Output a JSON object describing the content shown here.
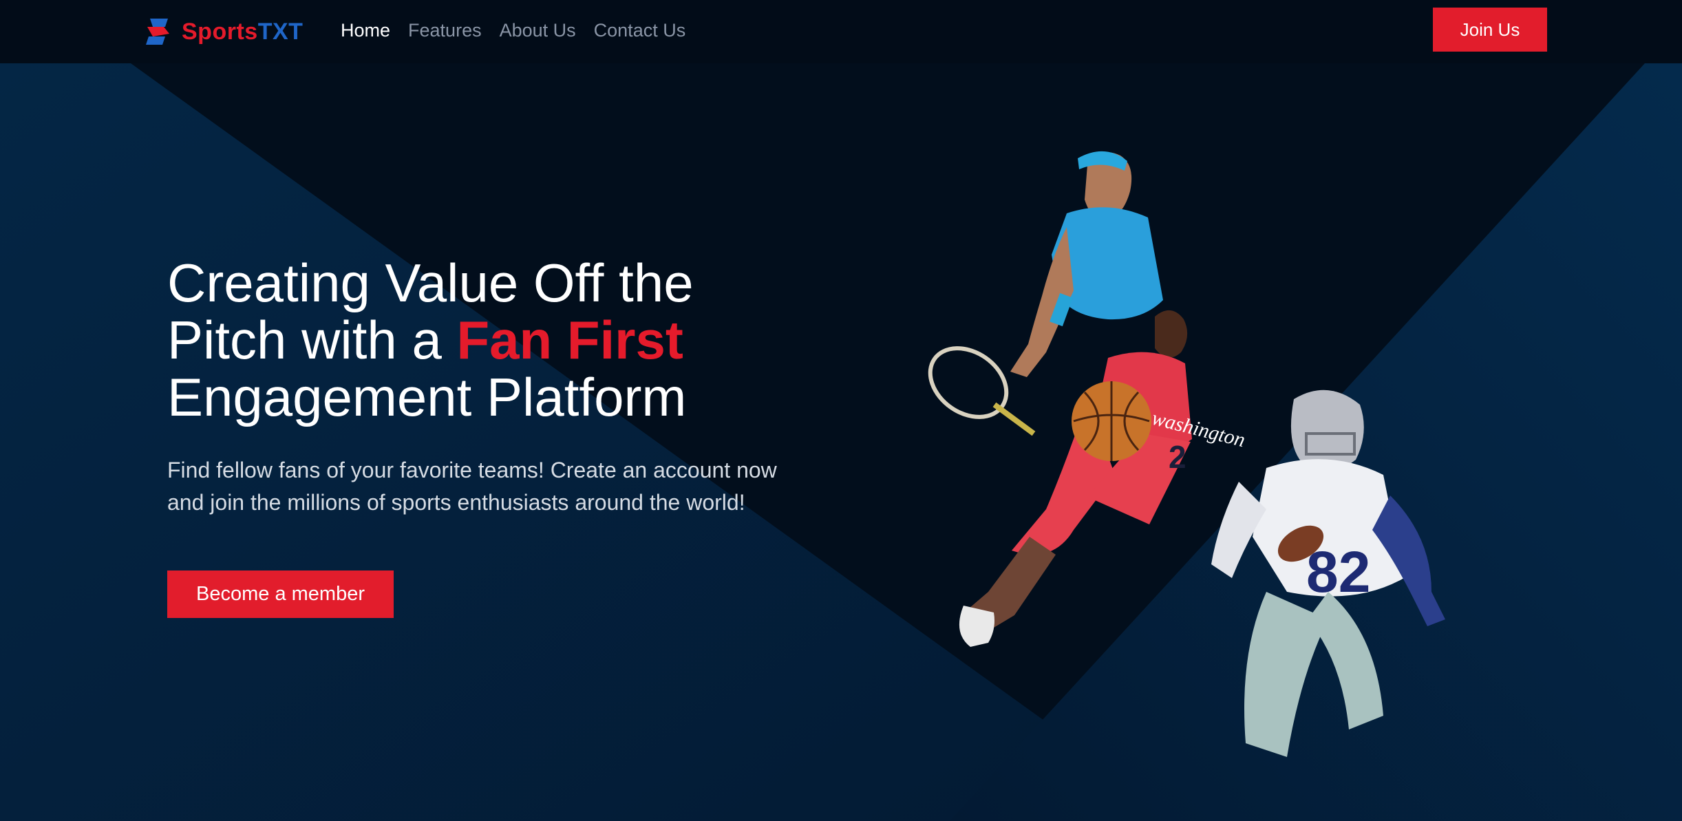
{
  "brand": {
    "name_part1": "Sports",
    "name_part2": "TXT",
    "logo_icon": "sportstxt-logo-icon",
    "colors": {
      "red": "#e51b2b",
      "blue": "#1f66c8"
    }
  },
  "nav": {
    "links": [
      {
        "label": "Home",
        "active": true
      },
      {
        "label": "Features",
        "active": false
      },
      {
        "label": "About Us",
        "active": false
      },
      {
        "label": "Contact Us",
        "active": false
      }
    ],
    "join_label": "Join Us"
  },
  "hero": {
    "title_line1": "Creating Value Off the",
    "title_line2_start": "Pitch with a ",
    "title_highlight": "Fan First",
    "title_line3": "Engagement Platform",
    "subtitle_line1": "Find fellow fans of your favorite teams! Create an account now",
    "subtitle_line2": "and join the millions of sports enthusiasts around the world!",
    "cta_label": "Become a member",
    "image_jersey_basketball": "washington",
    "image_jersey_number_basketball": "2",
    "image_jersey_number_football": "82"
  },
  "colors": {
    "background": "#020f1e",
    "panel": "#04213d",
    "accent": "#e21d2c"
  }
}
